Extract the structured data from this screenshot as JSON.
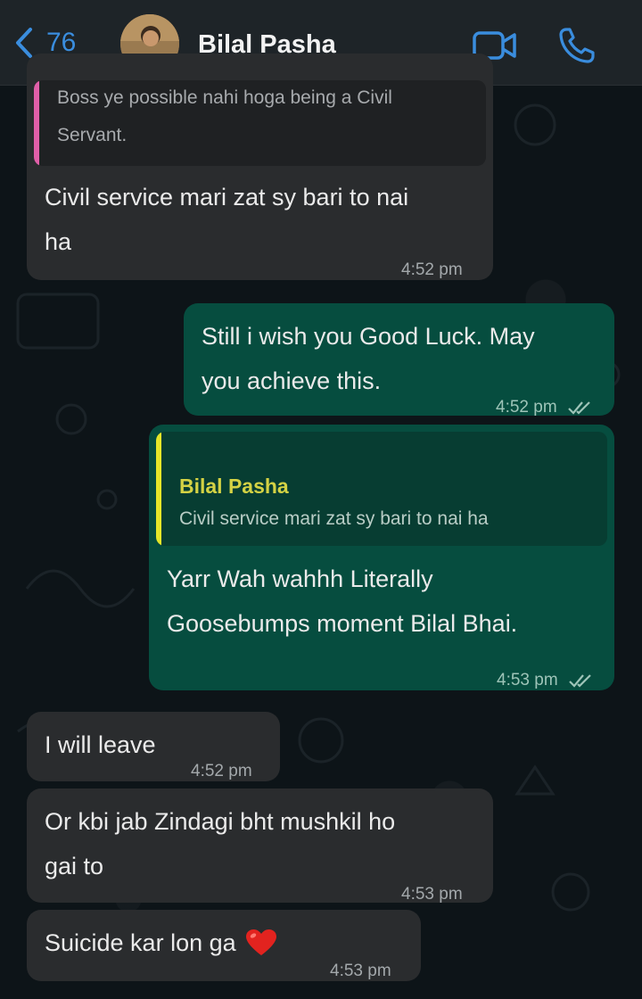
{
  "header": {
    "back_count": "76",
    "contact_name": "Bilal Pasha",
    "icons": [
      "chevron-left-icon",
      "video-call-icon",
      "phone-call-icon"
    ],
    "accent_color": "#3a8dde"
  },
  "messages": [
    {
      "direction": "incoming",
      "quote_text_line1": "Boss ye possible nahi hoga being a Civil",
      "quote_text_line2": "Servant.",
      "quote_bar_color": "#e05fa8",
      "text_line1": "Civil service mari zat sy bari to nai",
      "text_line2": "ha",
      "time": "4:52 pm"
    },
    {
      "direction": "outgoing",
      "text_line1": "Still i wish you Good Luck. May",
      "text_line2": "you achieve this.",
      "time": "4:52 pm",
      "status": "read"
    },
    {
      "direction": "outgoing",
      "quote_sender": "Bilal Pasha",
      "quote_text": "Civil service mari zat sy bari to nai ha",
      "quote_bar_color": "#e6e629",
      "text_line1": "Yarr Wah wahhh Literally",
      "text_line2": "Goosebumps moment Bilal Bhai.",
      "time": "4:53 pm",
      "status": "read"
    },
    {
      "direction": "incoming",
      "text": "I will leave",
      "time": "4:52 pm"
    },
    {
      "direction": "incoming",
      "text_line1": "Or kbi jab Zindagi bht mushkil ho",
      "text_line2": "gai to",
      "time": "4:53 pm"
    },
    {
      "direction": "incoming",
      "text": "Suicide kar lon ga",
      "emoji": "heart-icon",
      "time": "4:53 pm"
    }
  ],
  "colors": {
    "incoming_bubble": "#2a2c2e",
    "outgoing_bubble": "#064d3f",
    "background": "#0d1418"
  }
}
